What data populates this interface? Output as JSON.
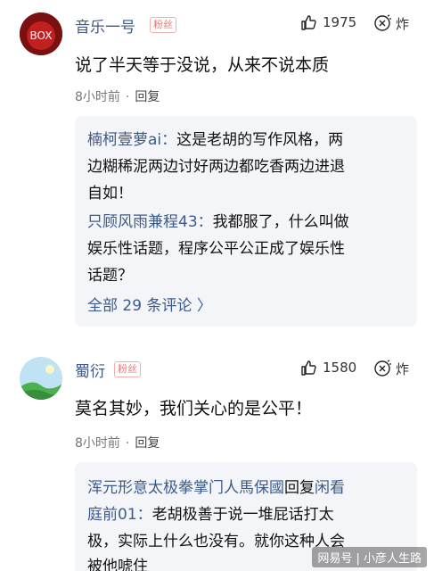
{
  "comments": [
    {
      "username": "音乐一号",
      "badge": "粉丝",
      "likes": "1975",
      "react_label": "炸",
      "text": "说了半天等于没说，从来不说本质",
      "time": "8小时前",
      "reply_label": "回复",
      "replies_lines": [
        {
          "author": "楠柯壹萝ai：",
          "text": "这是老胡的写作风格，两"
        },
        {
          "author": "",
          "text": "边糊稀泥两边讨好两边都吃香两边进退"
        },
        {
          "author": "",
          "text": "自如！"
        },
        {
          "author": "只顾风雨兼程43：",
          "text": "我都服了，什么叫做"
        },
        {
          "author": "",
          "text": "娱乐性话题，程序公平公正成了娱乐性"
        },
        {
          "author": "",
          "text": "话题？"
        }
      ],
      "see_all": "全部 29 条评论 〉"
    },
    {
      "username": "蜀衍",
      "badge": "粉丝",
      "likes": "1580",
      "react_label": "炸",
      "text": "莫名其妙，我们关心的是公平！",
      "time": "8小时前",
      "reply_label": "回复",
      "replies_lines": [
        {
          "author": "浑元形意太极拳掌门人馬保國",
          "text": "回复"
        },
        {
          "author": "庭前01：",
          "text": "老胡极善于说一堆屁话打太"
        },
        {
          "author": "",
          "text": "极，实际上什么也没有。就你这种人会"
        },
        {
          "author": "",
          "text": "被他唬住"
        }
      ],
      "reply_target": "闲看"
    }
  ],
  "watermark": "网易号 | 小彦人生路"
}
